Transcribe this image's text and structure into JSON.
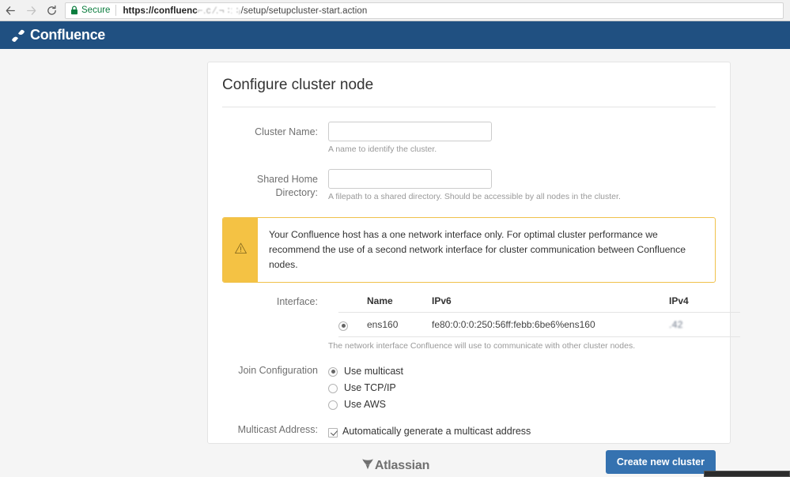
{
  "browser": {
    "back_icon": "back-arrow-icon",
    "forward_icon": "forward-arrow-icon",
    "reload_icon": "reload-icon",
    "lock_icon": "lock-icon",
    "secure_label": "Secure",
    "url_host": "https://confluenc",
    "url_redacted": "⌐.c  ⁄.¬ ∶ː ∶ⱼ",
    "url_path": "/setup/setupcluster-start.action"
  },
  "app_header": {
    "brand_mark": "atlassian-confluence-logo-icon",
    "brand_text": "Confluence",
    "brand_color": "#205081"
  },
  "card": {
    "title": "Configure cluster node",
    "fields": {
      "cluster_name": {
        "label": "Cluster Name:",
        "value": "",
        "placeholder": "",
        "hint": "A name to identify the cluster."
      },
      "shared_home": {
        "label": "Shared Home Directory:",
        "value": "",
        "placeholder": "",
        "hint": "A filepath to a shared directory. Should be accessible by all nodes in the cluster."
      }
    },
    "warning": {
      "icon": "warning-triangle-icon",
      "accent_color": "#f4c244",
      "text": "Your Confluence host has a one network interface only. For optimal cluster performance we recommend the use of a second network interface for cluster communication between Confluence nodes."
    },
    "interface": {
      "label": "Interface:",
      "columns": [
        "",
        "Name",
        "IPv6",
        "IPv4"
      ],
      "rows": [
        {
          "selected": true,
          "name": "ens160",
          "ipv6": "fe80:0:0:0:250:56ff:febb:6be6%ens160",
          "ipv4": ".42"
        }
      ],
      "hint": "The network interface Confluence will use to communicate with other cluster nodes."
    },
    "join_configuration": {
      "label": "Join Configuration",
      "options": [
        {
          "label": "Use multicast",
          "selected": true
        },
        {
          "label": "Use TCP/IP",
          "selected": false
        },
        {
          "label": "Use AWS",
          "selected": false
        }
      ]
    },
    "multicast_address": {
      "label": "Multicast Address:",
      "checkbox_label": "Automatically generate a multicast address",
      "checked": true
    },
    "submit_button": {
      "label": "Create new cluster",
      "color": "#3572b0"
    }
  },
  "footer": {
    "logo_icon": "atlassian-logo-icon",
    "logo_text": "Atlassian"
  }
}
